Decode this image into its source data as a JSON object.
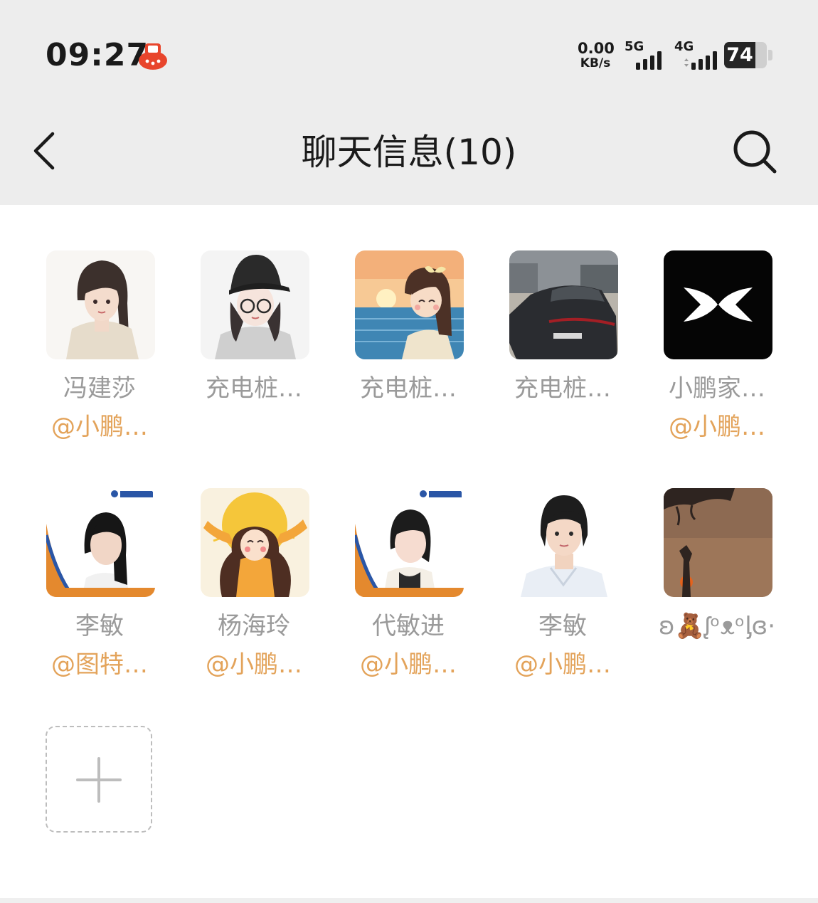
{
  "status_bar": {
    "time": "09:27",
    "net_speed_value": "0.00",
    "net_speed_unit": "KB/s",
    "signal_1_label": "5G",
    "signal_2_label": "4G",
    "battery_percent": 74
  },
  "header": {
    "title": "聊天信息(10)",
    "back_icon": "chevron-left-icon",
    "search_icon": "search-icon"
  },
  "members": [
    {
      "name": "冯建莎",
      "tag": "@小鹏…"
    },
    {
      "name": "充电桩…",
      "tag": ""
    },
    {
      "name": "充电桩…",
      "tag": ""
    },
    {
      "name": "充电桩…",
      "tag": ""
    },
    {
      "name": "小鹏家…",
      "tag": "@小鹏…"
    },
    {
      "name": "李敏",
      "tag": "@图特…"
    },
    {
      "name": "杨海玲",
      "tag": "@小鹏…"
    },
    {
      "name": "代敏进",
      "tag": "@小鹏…"
    },
    {
      "name": "李敏",
      "tag": "@小鹏…"
    },
    {
      "name": "ʚ🧸ᶘᵒᴥᵒᶅɞ·",
      "tag": ""
    }
  ],
  "add_member": {
    "icon": "plus-icon"
  },
  "colors": {
    "header_bg": "#ededed",
    "name_gray": "#9a9a9a",
    "tag_orange": "#e3a35a"
  }
}
